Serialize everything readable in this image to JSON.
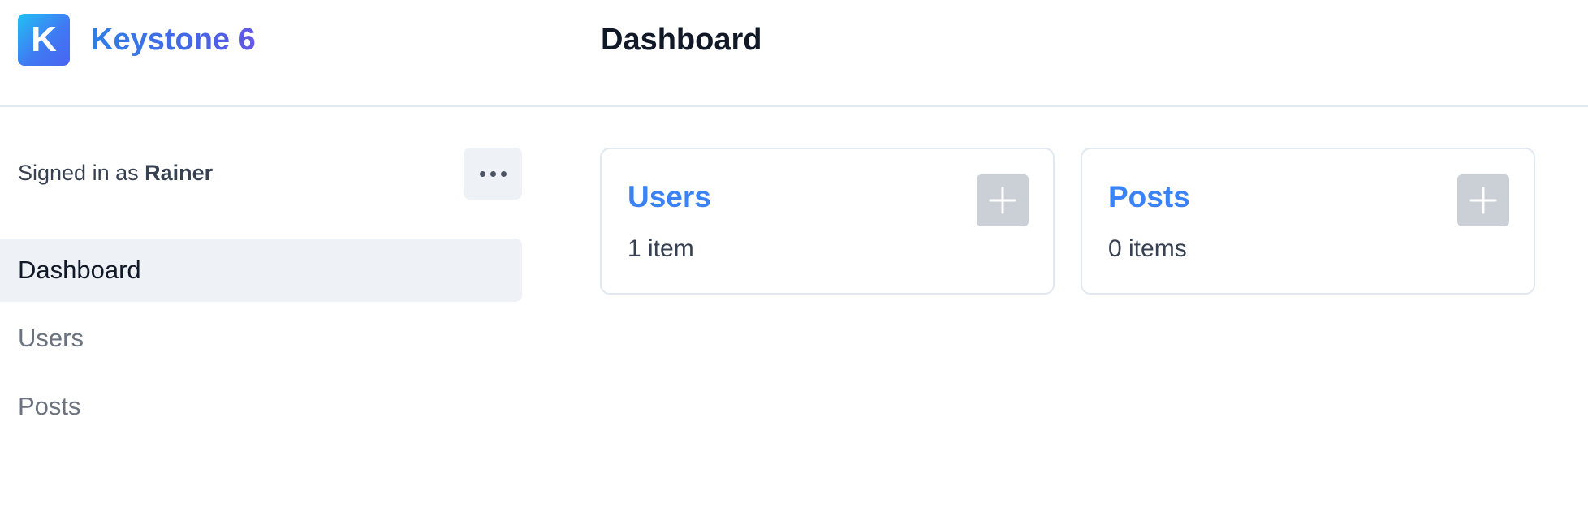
{
  "header": {
    "logo_letter": "K",
    "brand_name": "Keystone 6",
    "page_title": "Dashboard"
  },
  "sidebar": {
    "signed_in_prefix": "Signed in as",
    "signed_in_user": "Rainer",
    "more_icon": "more-horizontal-icon",
    "items": [
      {
        "label": "Dashboard",
        "active": true
      },
      {
        "label": "Users",
        "active": false
      },
      {
        "label": "Posts",
        "active": false
      }
    ]
  },
  "cards": [
    {
      "title": "Users",
      "count": "1 item",
      "add_icon": "plus-icon"
    },
    {
      "title": "Posts",
      "count": "0 items",
      "add_icon": "plus-icon"
    }
  ],
  "colors": {
    "accent": "#3b82f6",
    "active_bg": "#eef2f6",
    "border": "#e2e8f0",
    "add_button_bg": "#cbd0d6"
  }
}
